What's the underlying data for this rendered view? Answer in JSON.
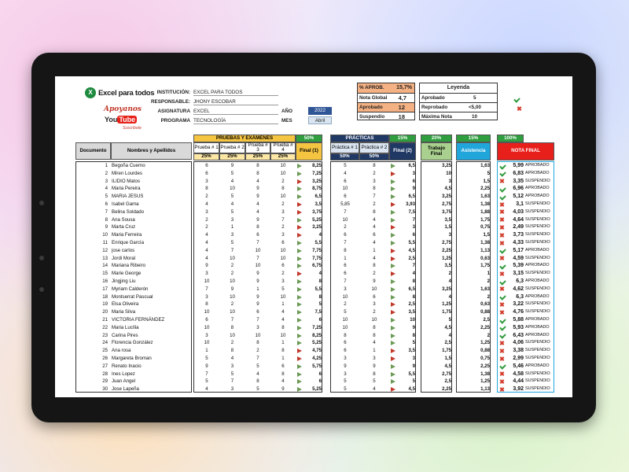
{
  "logo": {
    "text": "Excel para todos",
    "apoyanos": "Apoyanos",
    "youtube": "You",
    "tube": "Tube",
    "suscribe": "Suscríbete"
  },
  "info": {
    "institucion_label": "INSTITUCIÓN:",
    "institucion": "EXCEL PARA TODOS",
    "responsable_label": "RESPONSABLE:",
    "responsable": "JHONY ESCOBAR",
    "asignatura_label": "ASIGNATURA",
    "asignatura": "EXCEL",
    "programa_label": "PROGRAMA",
    "programa": "TECNOLOGÍA",
    "anio_label": "AÑO",
    "anio": "2022",
    "mes_label": "MES",
    "mes": "Abril"
  },
  "summary": {
    "aprob_label": "% APROB.",
    "aprob": "15,7%",
    "nota_global_label": "Nota Global",
    "nota_global": "4,7",
    "aprobado_label": "Aprobado",
    "aprobado": "12",
    "suspendio_label": "Suspendio",
    "suspendio": "18"
  },
  "legend": {
    "title": "Leyenda",
    "aprobado_label": "Aprobado",
    "aprobado_val": "5",
    "reprobado_label": "Reprobado",
    "reprobado_val": "<5,00",
    "maxima_label": "Máxima Nota",
    "maxima_val": "10"
  },
  "headers": {
    "documento": "Documento",
    "nombres": "Nombres y Apellidos",
    "pruebas": "PRUEBAS Y EXÁMENES",
    "pruebas_pct": "50%",
    "p1": "Prueba # 1",
    "p2": "Prueba # 2",
    "p3": "Prueba # 3",
    "p4": "Prueba # 4",
    "pp1": "25%",
    "pp2": "25%",
    "pp3": "25%",
    "pp4": "25%",
    "final1": "Final (1)",
    "practicas": "PRÁCTICAS",
    "practicas_pct": "15%",
    "pr1": "Práctica # 1",
    "pr2": "Práctica # 2",
    "prp1": "50%",
    "prp2": "50%",
    "final2": "Final (2)",
    "trabajo_pct": "20%",
    "trabajo": "Trabajo Final",
    "asistencia_pct": "15%",
    "asistencia": "Asistencia",
    "nota_pct": "100%",
    "nota": "NOTA FINAL"
  },
  "students": [
    [
      "1",
      "Begoña Cuerno",
      "6",
      "9",
      "8",
      "10",
      "8,25",
      "5",
      "8",
      "6,5",
      "3,25",
      "1,63",
      "5,99",
      "APROBADO"
    ],
    [
      "2",
      "Miren Lourdes",
      "6",
      "5",
      "8",
      "10",
      "7,25",
      "4",
      "2",
      "3",
      "10",
      "5",
      "6,83",
      "APROBADO"
    ],
    [
      "3",
      "ILIDIO Matos",
      "3",
      "4",
      "4",
      "2",
      "3,25",
      "6",
      "3",
      "6",
      "3",
      "1,5",
      "3,35",
      "SUSPENDIO"
    ],
    [
      "4",
      "Maria Pereira",
      "8",
      "10",
      "9",
      "8",
      "8,75",
      "10",
      "8",
      "9",
      "4,5",
      "2,25",
      "6,96",
      "APROBADO"
    ],
    [
      "5",
      "MARIA JESUS",
      "2",
      "5",
      "9",
      "10",
      "6,5",
      "6",
      "7",
      "6,5",
      "3,25",
      "1,63",
      "5,12",
      "APROBADO"
    ],
    [
      "6",
      "Isabel Gama",
      "4",
      "4",
      "4",
      "2",
      "3,5",
      "5,85",
      "2",
      "3,93",
      "2,75",
      "1,38",
      "3,1",
      "SUSPENDIO"
    ],
    [
      "7",
      "Belina Soldado",
      "3",
      "5",
      "4",
      "3",
      "3,75",
      "7",
      "8",
      "7,5",
      "3,75",
      "1,88",
      "4,03",
      "SUSPENDIO"
    ],
    [
      "8",
      "Ana Sousa",
      "2",
      "3",
      "9",
      "7",
      "5,25",
      "10",
      "4",
      "7",
      "3,5",
      "1,75",
      "4,64",
      "SUSPENDIO"
    ],
    [
      "9",
      "Marta Cruz",
      "2",
      "1",
      "8",
      "2",
      "3,25",
      "2",
      "4",
      "3",
      "1,5",
      "0,75",
      "2,49",
      "SUSPENDIO"
    ],
    [
      "10",
      "Maria Ferreira",
      "4",
      "3",
      "6",
      "3",
      "4",
      "6",
      "6",
      "6",
      "3",
      "1,5",
      "3,73",
      "SUSPENDIO"
    ],
    [
      "11",
      "Enrique García",
      "4",
      "5",
      "7",
      "6",
      "5,5",
      "7",
      "4",
      "5,5",
      "2,75",
      "1,38",
      "4,33",
      "SUSPENDIO"
    ],
    [
      "12",
      "jose carlos",
      "4",
      "7",
      "10",
      "10",
      "7,75",
      "8",
      "1",
      "4,5",
      "2,25",
      "1,13",
      "5,17",
      "APROBADO"
    ],
    [
      "13",
      "Jordi Moral",
      "4",
      "10",
      "7",
      "10",
      "7,75",
      "1",
      "4",
      "2,5",
      "1,25",
      "0,63",
      "4,59",
      "SUSPENDIO"
    ],
    [
      "14",
      "Mariana Ribeiro",
      "9",
      "2",
      "10",
      "6",
      "6,75",
      "6",
      "8",
      "7",
      "3,5",
      "1,75",
      "5,39",
      "APROBADO"
    ],
    [
      "15",
      "Marie George",
      "3",
      "2",
      "9",
      "2",
      "4",
      "6",
      "2",
      "4",
      "2",
      "1",
      "3,15",
      "SUSPENDIO"
    ],
    [
      "16",
      "Jingjing Liu",
      "10",
      "10",
      "9",
      "3",
      "8",
      "7",
      "9",
      "8",
      "4",
      "2",
      "6,3",
      "APROBADO"
    ],
    [
      "17",
      "Myriam Calderón",
      "7",
      "9",
      "1",
      "5",
      "5,5",
      "3",
      "10",
      "6,5",
      "3,25",
      "1,63",
      "4,62",
      "SUSPENDIO"
    ],
    [
      "18",
      "Montserrat Pascual",
      "3",
      "10",
      "9",
      "10",
      "8",
      "10",
      "6",
      "8",
      "4",
      "2",
      "6,3",
      "APROBADO"
    ],
    [
      "19",
      "Elsa Oliveira",
      "8",
      "2",
      "9",
      "1",
      "5",
      "2",
      "3",
      "2,5",
      "1,25",
      "0,63",
      "3,22",
      "SUSPENDIO"
    ],
    [
      "20",
      "Maria Silva",
      "10",
      "10",
      "6",
      "4",
      "7,5",
      "5",
      "2",
      "3,5",
      "1,75",
      "0,88",
      "4,76",
      "SUSPENDIO"
    ],
    [
      "21",
      "VICTORIA FERNÁNDEZ",
      "6",
      "7",
      "7",
      "4",
      "6",
      "10",
      "10",
      "10",
      "5",
      "2,5",
      "5,88",
      "APROBADO"
    ],
    [
      "22",
      "Maria Lucília",
      "10",
      "8",
      "3",
      "8",
      "7,25",
      "10",
      "8",
      "9",
      "4,5",
      "2,25",
      "5,93",
      "APROBADO"
    ],
    [
      "23",
      "Carina Pires",
      "3",
      "10",
      "10",
      "10",
      "8,25",
      "8",
      "8",
      "8",
      "4",
      "2",
      "6,43",
      "APROBADO"
    ],
    [
      "24",
      "Florencia González",
      "10",
      "2",
      "8",
      "1",
      "5,25",
      "6",
      "4",
      "5",
      "2,5",
      "1,25",
      "4,06",
      "SUSPENDIO"
    ],
    [
      "25",
      "Ana rosa",
      "1",
      "8",
      "2",
      "8",
      "4,75",
      "6",
      "1",
      "3,5",
      "1,75",
      "0,88",
      "3,38",
      "SUSPENDIO"
    ],
    [
      "26",
      "Margareta Broman",
      "5",
      "4",
      "7",
      "1",
      "4,25",
      "3",
      "3",
      "3",
      "1,5",
      "0,75",
      "2,99",
      "SUSPENDIO"
    ],
    [
      "27",
      "Renato Inacio",
      "9",
      "3",
      "5",
      "6",
      "5,75",
      "9",
      "9",
      "9",
      "4,5",
      "2,25",
      "5,46",
      "APROBADO"
    ],
    [
      "28",
      "Ines Lopez",
      "7",
      "5",
      "4",
      "8",
      "6",
      "3",
      "8",
      "5,5",
      "2,75",
      "1,38",
      "4,58",
      "SUSPENDIO"
    ],
    [
      "29",
      "Juan Angel",
      "5",
      "7",
      "8",
      "4",
      "6",
      "5",
      "5",
      "5",
      "2,5",
      "1,25",
      "4,44",
      "SUSPENDIO"
    ],
    [
      "30",
      "Jose Lapeña",
      "4",
      "3",
      "5",
      "9",
      "5,25",
      "5",
      "4",
      "4,5",
      "2,25",
      "1,13",
      "3,92",
      "SUSPENDIO"
    ]
  ],
  "colors": {
    "yellow": "#f5c542",
    "navy": "#1f3864",
    "green": "#2e9e3e",
    "blue": "#21a6dc",
    "red": "#e8201c",
    "salmon": "#f4b183",
    "tan": "#d9c9a8"
  }
}
